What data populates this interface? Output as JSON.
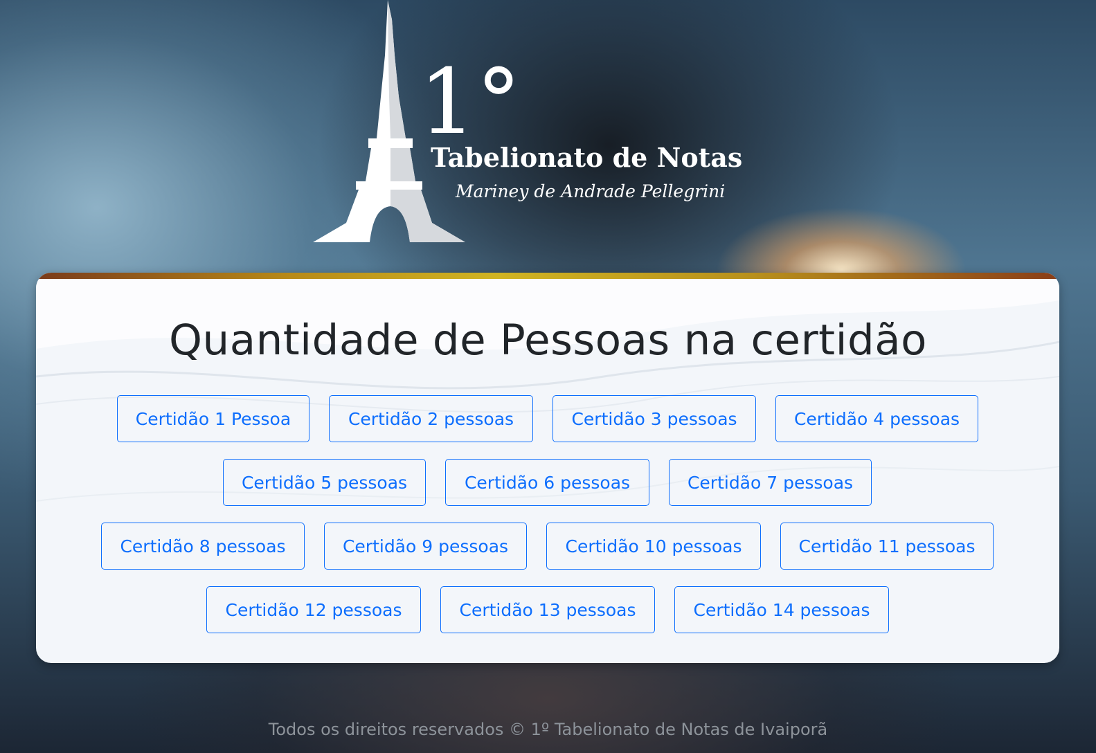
{
  "logo": {
    "number": "1°",
    "title": "Tabelionato de Notas",
    "subtitle": "Mariney de Andrade Pellegrini"
  },
  "main": {
    "title": "Quantidade de Pessoas na certidão",
    "buttons": [
      "Certidão 1 Pessoa",
      "Certidão 2 pessoas",
      "Certidão 3 pessoas",
      "Certidão 4 pessoas",
      "Certidão 5 pessoas",
      "Certidão 6 pessoas",
      "Certidão 7 pessoas",
      "Certidão 8 pessoas",
      "Certidão 9 pessoas",
      "Certidão 10 pessoas",
      "Certidão 11 pessoas",
      "Certidão 12 pessoas",
      "Certidão 13 pessoas",
      "Certidão 14 pessoas"
    ]
  },
  "footer": {
    "text": "Todos os direitos reservados © 1º Tabelionato de Notas de Ivaiporã"
  },
  "colors": {
    "button_accent": "#0d6efd",
    "card_background": "#f3f6fa",
    "title_text": "#212529"
  },
  "icons": [
    "eiffel-tower-icon"
  ]
}
